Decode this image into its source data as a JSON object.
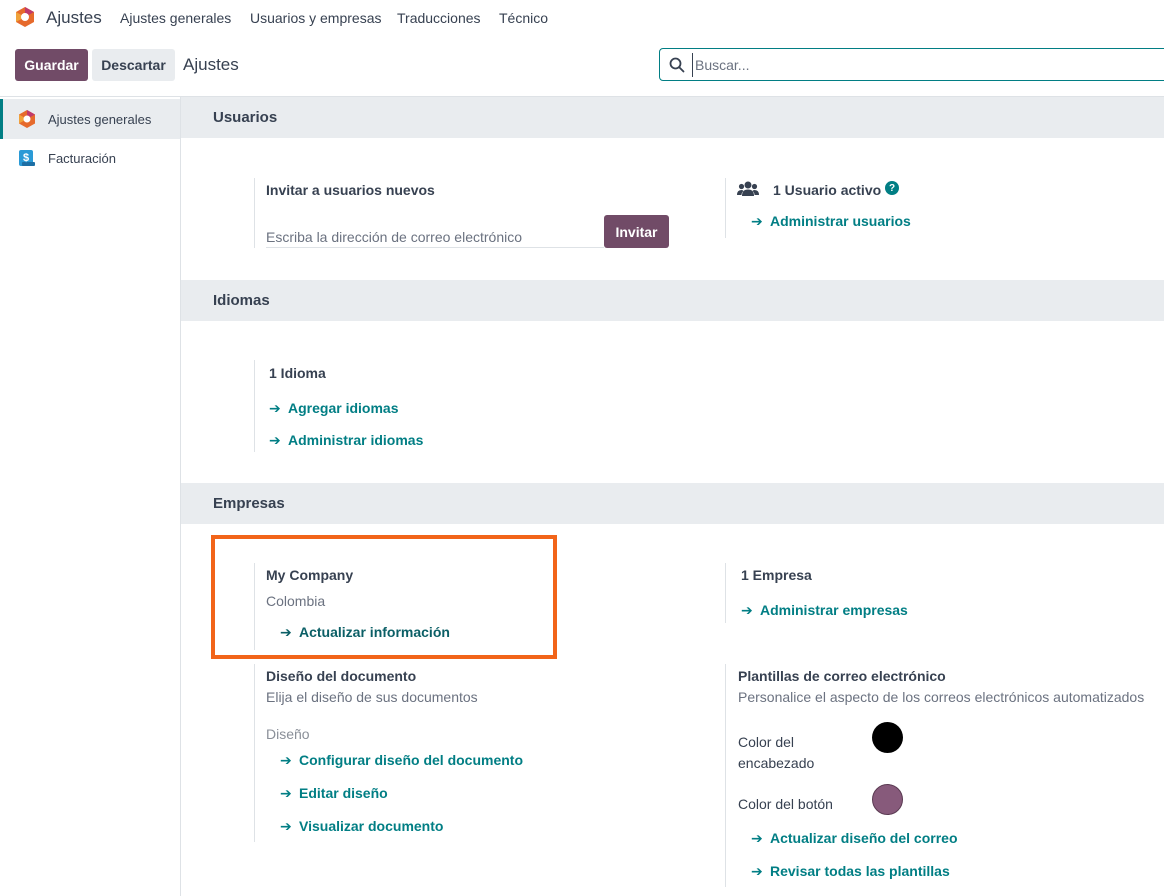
{
  "navbar": {
    "app_name": "Ajustes",
    "menu": [
      "Ajustes generales",
      "Usuarios y empresas",
      "Traducciones",
      "Técnico"
    ]
  },
  "control_panel": {
    "save_label": "Guardar",
    "discard_label": "Descartar",
    "breadcrumb": "Ajustes",
    "search_placeholder": "Buscar..."
  },
  "sidebar": {
    "items": [
      {
        "label": "Ajustes generales",
        "icon": "settings-app-icon",
        "active": true
      },
      {
        "label": "Facturación",
        "icon": "invoicing-app-icon",
        "active": false
      }
    ]
  },
  "sections": {
    "users": {
      "title": "Usuarios",
      "invite_title": "Invitar a usuarios nuevos",
      "invite_placeholder": "Escriba la dirección de correo electrónico",
      "invite_button": "Invitar",
      "active_users": "1 Usuario activo",
      "manage_users": "Administrar usuarios"
    },
    "languages": {
      "title": "Idiomas",
      "count": "1 Idioma",
      "add_languages": "Agregar idiomas",
      "manage_languages": "Administrar idiomas"
    },
    "companies": {
      "title": "Empresas",
      "company_name": "My Company",
      "company_country": "Colombia",
      "update_info": "Actualizar información",
      "count": "1 Empresa",
      "manage_companies": "Administrar empresas",
      "document_layout": {
        "title": "Diseño del documento",
        "description": "Elija el diseño de sus documentos",
        "layout_label": "Diseño",
        "configure": "Configurar diseño del documento",
        "edit": "Editar diseño",
        "preview": "Visualizar documento"
      },
      "email_templates": {
        "title": "Plantillas de correo electrónico",
        "description": "Personalice el aspecto de los correos electrónicos automatizados",
        "header_color_label_1": "Color del",
        "header_color_label_2": "encabezado",
        "header_color": "#000000",
        "button_color_label": "Color del botón",
        "button_color": "#875a7b",
        "update_design": "Actualizar diseño del correo",
        "review_templates": "Revisar todas las plantillas"
      }
    }
  },
  "colors": {
    "brand": "#714b67",
    "link": "#017e84",
    "highlight": "#f26419"
  }
}
